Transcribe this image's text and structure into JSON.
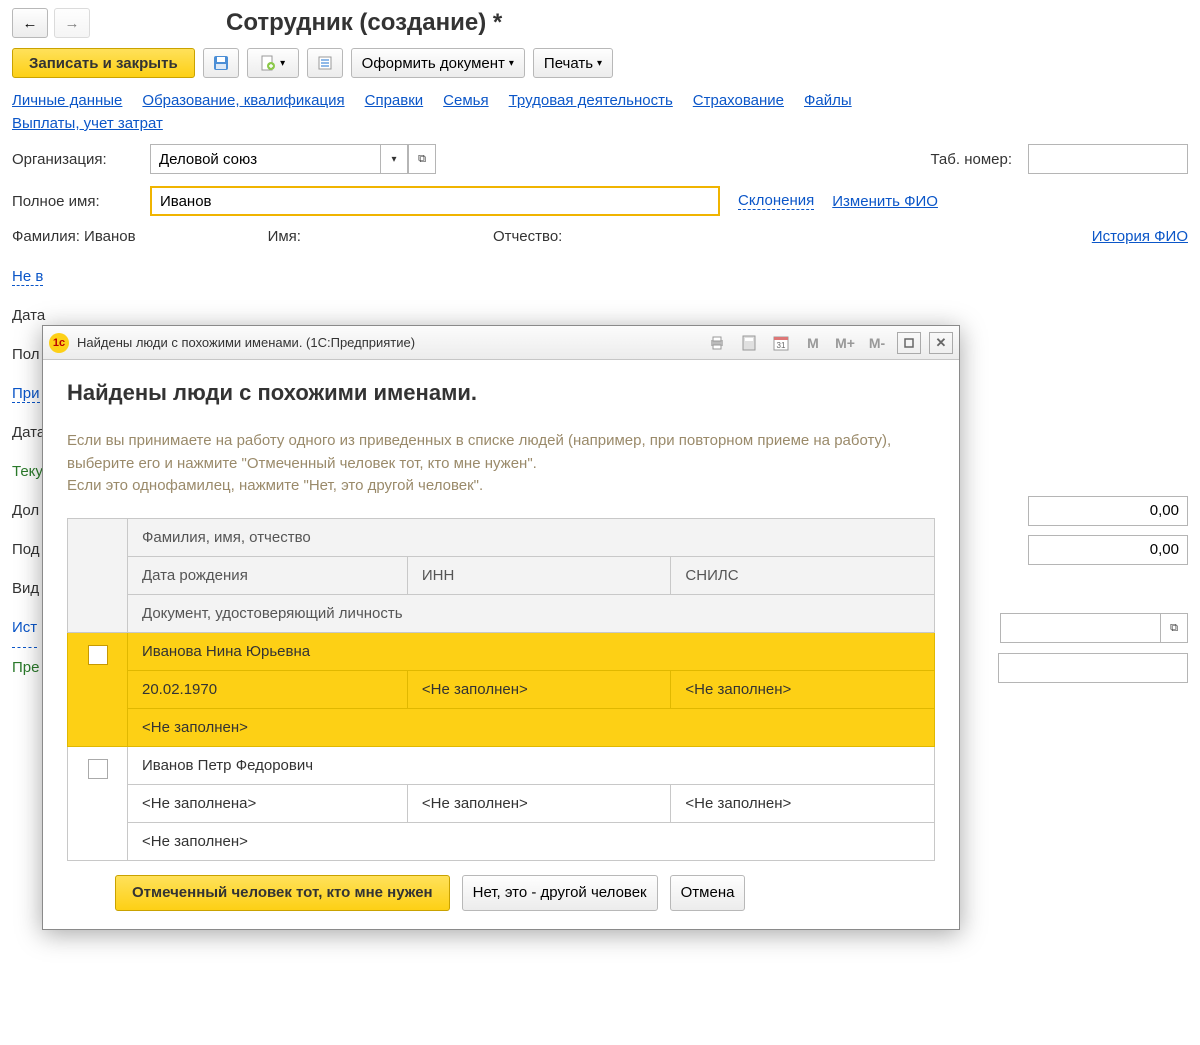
{
  "nav": {
    "back": "←",
    "forward": "→"
  },
  "pageTitle": "Сотрудник (создание) *",
  "toolbar": {
    "saveClose": "Записать и закрыть",
    "docBtn": "Оформить документ",
    "printBtn": "Печать"
  },
  "links": {
    "personal": "Личные данные",
    "education": "Образование, квалификация",
    "refs": "Справки",
    "family": "Семья",
    "work": "Трудовая деятельность",
    "insurance": "Страхование",
    "files": "Файлы",
    "payouts": "Выплаты, учет затрат"
  },
  "form": {
    "orgLabel": "Организация:",
    "orgValue": "Деловой союз",
    "tabNumLabel": "Таб. номер:",
    "tabNumValue": "",
    "fullNameLabel": "Полное имя:",
    "fullNameValue": "Иванов",
    "declensions": "Склонения",
    "changeFio": "Изменить ФИО",
    "lastNameLabel": "Фамилия:",
    "lastNameValue": "Иванов",
    "nameLabel": "Имя:",
    "middleLabel": "Отчество:",
    "fioHistory": "История ФИО",
    "neVLabel": "Не в",
    "dateLabel": "Дата",
    "polLabel": "Пол",
    "priLabel": "При",
    "tekuLabel": "Теку",
    "dolaLabel": "Дол",
    "podLabel": "Под",
    "vidLabel": "Вид",
    "istLabel": "Ист",
    "preLabel": "Пре",
    "zero": "0,00"
  },
  "dialog": {
    "titlebar": "Найдены люди с похожими именами.  (1С:Предприятие)",
    "heading": "Найдены люди с похожими именами.",
    "desc1": "Если вы принимаете на работу одного из приведенных в списке людей (например, при повторном приеме на работу), выберите его и нажмите \"Отмеченный человек тот, кто мне нужен\".",
    "desc2": "Если это однофамилец, нажмите \"Нет, это другой человек\".",
    "headers": {
      "fio": "Фамилия, имя, отчество",
      "dob": "Дата рождения",
      "inn": "ИНН",
      "snils": "СНИЛС",
      "doc": "Документ, удостоверяющий личность"
    },
    "rows": [
      {
        "name": "Иванова Нина Юрьевна",
        "dob": "20.02.1970",
        "inn": "<Не заполнен>",
        "snils": "<Не заполнен>",
        "doc": "<Не заполнен>"
      },
      {
        "name": "Иванов Петр Федорович",
        "dob": "<Не заполнена>",
        "inn": "<Не заполнен>",
        "snils": "<Не заполнен>",
        "doc": "<Не заполнен>"
      }
    ],
    "buttons": {
      "ok": "Отмеченный человек тот, кто мне нужен",
      "no": "Нет, это - другой человек",
      "cancel": "Отмена"
    },
    "ticons": {
      "m": "M",
      "mplus": "M+",
      "mminus": "M-"
    }
  }
}
